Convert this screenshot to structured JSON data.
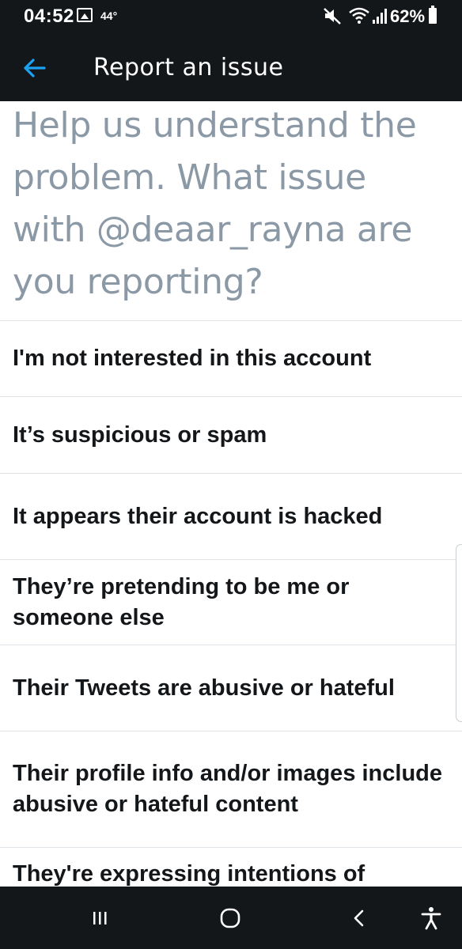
{
  "status_bar": {
    "time": "04:52",
    "temperature": "44°",
    "battery_percent": "62%",
    "icons": [
      "gallery-icon",
      "mute-icon",
      "wifi-icon",
      "signal-icon",
      "battery-icon"
    ]
  },
  "app_bar": {
    "title": "Report an issue",
    "back_icon": "arrow-left-icon",
    "accent_color": "#1da1f2"
  },
  "question": "Help us understand the problem. What issue with @deaar_rayna are you reporting?",
  "options": [
    {
      "label": "I'm not interested in this account"
    },
    {
      "label": "It’s suspicious or spam"
    },
    {
      "label": "It appears their account is hacked"
    },
    {
      "label": "They’re pretending to be me or someone else"
    },
    {
      "label": "Their Tweets are abusive or hateful"
    },
    {
      "label": "Their profile info and/or images include abusive or hateful content"
    },
    {
      "label": "They're expressing intentions of"
    }
  ],
  "nav_bar": {
    "icons": [
      "recents-icon",
      "home-icon",
      "back-icon",
      "accessibility-icon"
    ]
  },
  "colors": {
    "bar_background": "#14171a",
    "heading_text": "#8b98a5",
    "option_text": "#14171a",
    "divider": "#dfe4e8"
  }
}
